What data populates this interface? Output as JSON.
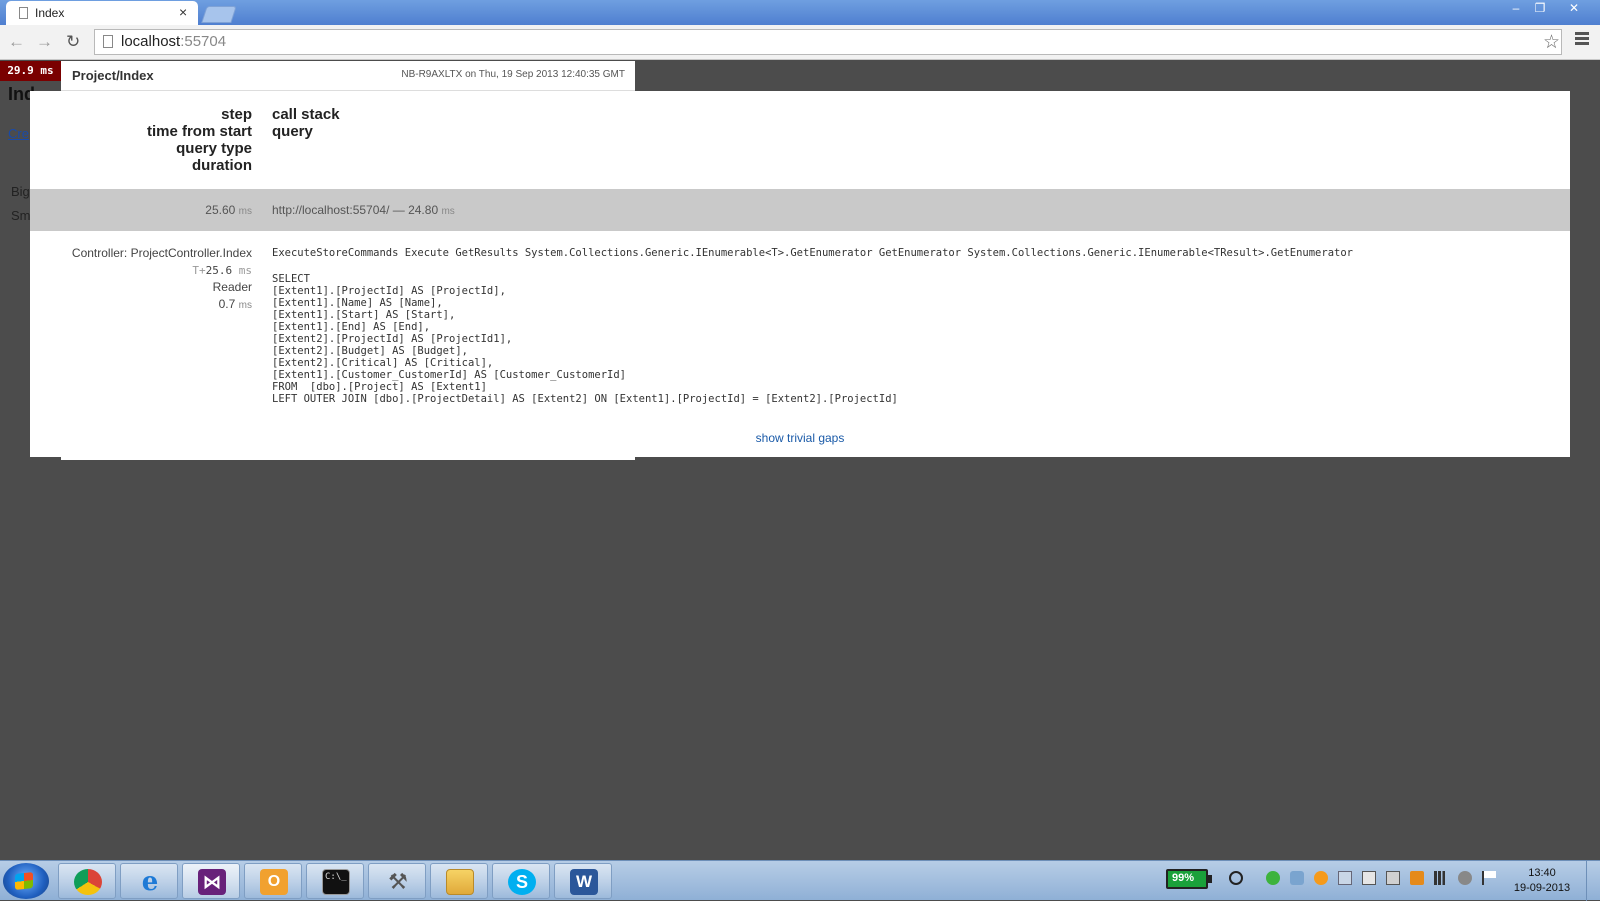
{
  "browser": {
    "tab_title": "Index",
    "tab_close": "×",
    "url_host": "localhost",
    "url_port": ":55704",
    "controls": {
      "minimize": "–",
      "maximize": "❐",
      "close": "✕"
    }
  },
  "page": {
    "heading_fragment": "Ind",
    "link_fragment": "Cre",
    "text1_fragment": "Big",
    "text2_fragment": "Sm"
  },
  "profiler": {
    "badge": "29.9 ms",
    "popup_name": "Project/Index",
    "server_info": "NB-R9AXLTX on Thu, 19 Sep 2013 12:40:35 GMT",
    "headers_left": [
      "step",
      "time from start",
      "query type",
      "duration"
    ],
    "headers_right": [
      "call stack",
      "query"
    ],
    "root_row": {
      "time": "25.60",
      "unit": "ms",
      "label": "http://localhost:55704/ — 24.80",
      "label_unit": "ms"
    },
    "detail": {
      "step": "Controller: ProjectController.Index",
      "time_prefix": "T+",
      "time_value": "25.6",
      "time_unit": "ms",
      "query_type": "Reader",
      "duration": "0.7",
      "duration_unit": "ms",
      "call_stack": "ExecuteStoreCommands Execute GetResults System.Collections.Generic.IEnumerable<T>.GetEnumerator GetEnumerator System.Collections.Generic.IEnumerable<TResult>.GetEnumerator",
      "query": "SELECT \n[Extent1].[ProjectId] AS [ProjectId], \n[Extent1].[Name] AS [Name], \n[Extent1].[Start] AS [Start], \n[Extent1].[End] AS [End], \n[Extent2].[ProjectId] AS [ProjectId1], \n[Extent2].[Budget] AS [Budget], \n[Extent2].[Critical] AS [Critical], \n[Extent1].[Customer_CustomerId] AS [Customer_CustomerId]\nFROM  [dbo].[Project] AS [Extent1]\nLEFT OUTER JOIN [dbo].[ProjectDetail] AS [Extent2] ON [Extent1].[ProjectId] = [Extent2].[ProjectId]"
    },
    "trivial_link": "show trivial gaps"
  },
  "taskbar": {
    "apps": [
      "chrome-icon",
      "internet-explorer-icon",
      "visual-studio-icon",
      "outlook-icon",
      "command-prompt-icon",
      "tools-icon",
      "file-explorer-icon",
      "skype-icon",
      "word-icon"
    ],
    "battery": "99%",
    "clock_time": "13:40",
    "clock_date": "19-09-2013"
  },
  "colors": {
    "badge_bg": "#7a0000",
    "link": "#1a5aa8",
    "row_gray": "#c9c9c9",
    "page_bg": "#4c4c4c"
  }
}
